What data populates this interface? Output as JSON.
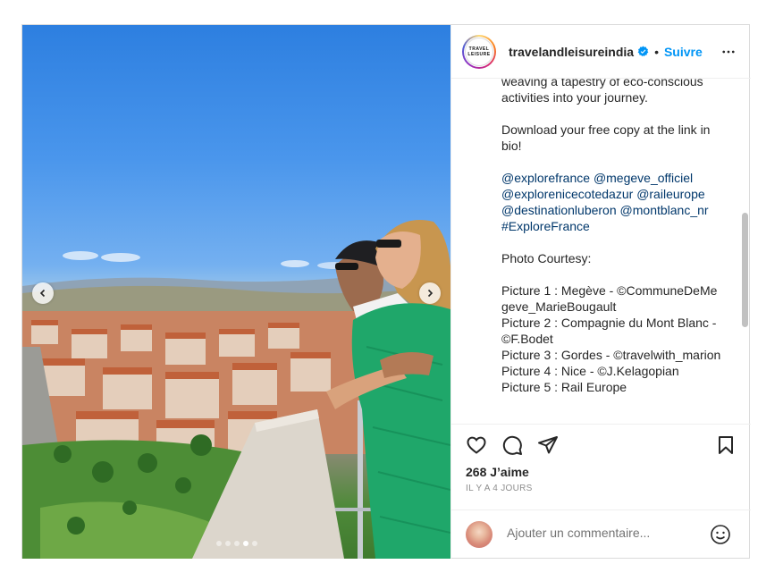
{
  "post": {
    "username": "travelandleisureindia",
    "avatar_text": [
      "TRAVEL",
      "LEISURE"
    ],
    "separator": "•",
    "follow_label": "Suivre",
    "likes_label": "268 J’aime",
    "time_label": "IL Y A 4 JOURS",
    "comment_placeholder": "Ajouter un commentaire..."
  },
  "caption": {
    "line_intro": "weaving a tapestry of eco-conscious activities into your journey.",
    "download": "Download your free copy at the link in bio!",
    "mentions": [
      "@explorefrance",
      "@megeve_officiel",
      "@explorenicecotedazur",
      "@raileurope",
      "@destinationluberon",
      "@montblanc_nr",
      "#ExploreFrance"
    ],
    "courtesy_title": "Photo Courtesy:",
    "courtesy_lines": [
      "Picture 1 : Megève - ©CommuneDeMegeve_MarieBougault",
      "Picture 2 : Compagnie du Mont Blanc - ©F.Bodet",
      "Picture 3 : Gordes - ©travelwith_marion",
      "Picture 4 : Nice - ©J.Kelagopian",
      "Picture 5 : Rail Europe"
    ]
  },
  "carousel": {
    "slide_count": 5,
    "active_index": 3
  },
  "icons": {
    "verified": "verified-badge-icon",
    "more": "more-options-icon",
    "like": "heart-icon",
    "comment": "comment-icon",
    "share": "share-icon",
    "save": "bookmark-icon",
    "prev": "chevron-left-icon",
    "next": "chevron-right-icon",
    "emoji": "emoji-icon"
  },
  "colors": {
    "accent": "#0095f6",
    "mention": "#00376b",
    "meta": "#8e8e8e",
    "border": "#dbdbdb"
  }
}
